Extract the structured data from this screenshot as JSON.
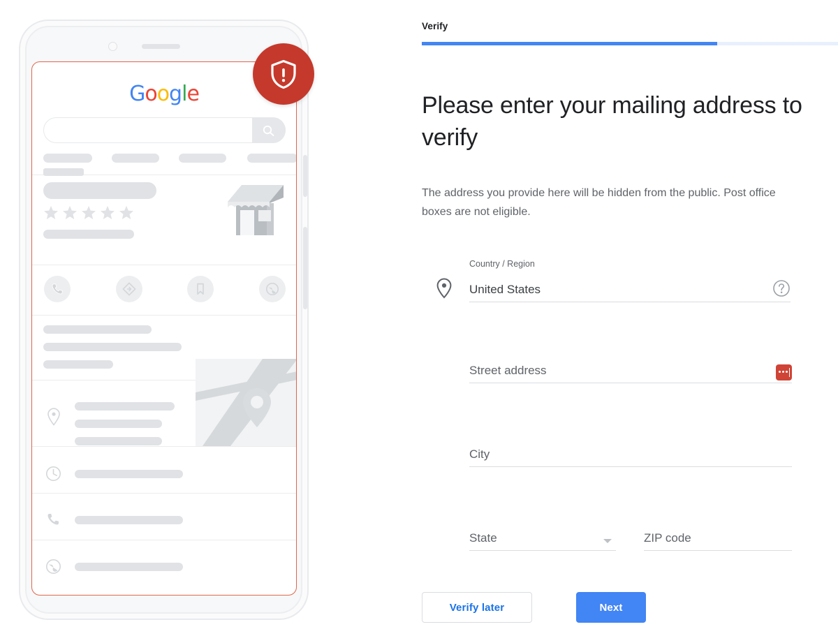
{
  "step": {
    "label": "Verify",
    "progress_percent": 71,
    "progress_fill_color": "#4285f4",
    "progress_track_color": "#e8f0fe"
  },
  "headline": "Please enter your mailing address to verify",
  "subtext": "The address you provide here will be hidden from the public. Post office boxes are not eligible.",
  "form": {
    "country": {
      "sublabel": "Country / Region",
      "value": "United States",
      "help_icon": "help-circle-icon",
      "leading_icon": "location-pin-icon"
    },
    "street": {
      "placeholder": "Street address",
      "value": "",
      "status_icon": "red-input-indicator-icon",
      "status_color": "#cf4436"
    },
    "city": {
      "placeholder": "City",
      "value": ""
    },
    "state": {
      "placeholder": "State",
      "value": "",
      "dropdown_icon": "chevron-down-icon"
    },
    "zip": {
      "placeholder": "ZIP code",
      "value": ""
    }
  },
  "actions": {
    "secondary_label": "Verify later",
    "primary_label": "Next",
    "primary_color": "#4285f4",
    "secondary_text_color": "#1a73e8"
  },
  "illustration": {
    "name": "phone-mockup-google-business-listing",
    "badge": {
      "icon": "shield-alert-icon",
      "color": "#c5392c"
    },
    "screen_highlight_color": "#e0654e",
    "google_logo": {
      "letters": [
        {
          "char": "G",
          "color": "#4285f4"
        },
        {
          "char": "o",
          "color": "#ea4335"
        },
        {
          "char": "o",
          "color": "#fbbc05"
        },
        {
          "char": "g",
          "color": "#4285f4"
        },
        {
          "char": "l",
          "color": "#34a853"
        },
        {
          "char": "e",
          "color": "#ea4335"
        }
      ]
    },
    "search_icon": "search-icon",
    "rating_stars": 5,
    "action_icons": [
      "call-icon",
      "directions-icon",
      "bookmark-icon",
      "website-icon"
    ],
    "detail_icons": [
      "clock-icon",
      "phone-icon",
      "globe-icon"
    ],
    "chevron_icon": "chevron-right-icon",
    "map_pin_icon": "map-pin-icon",
    "storefront_icon": "storefront-icon"
  }
}
